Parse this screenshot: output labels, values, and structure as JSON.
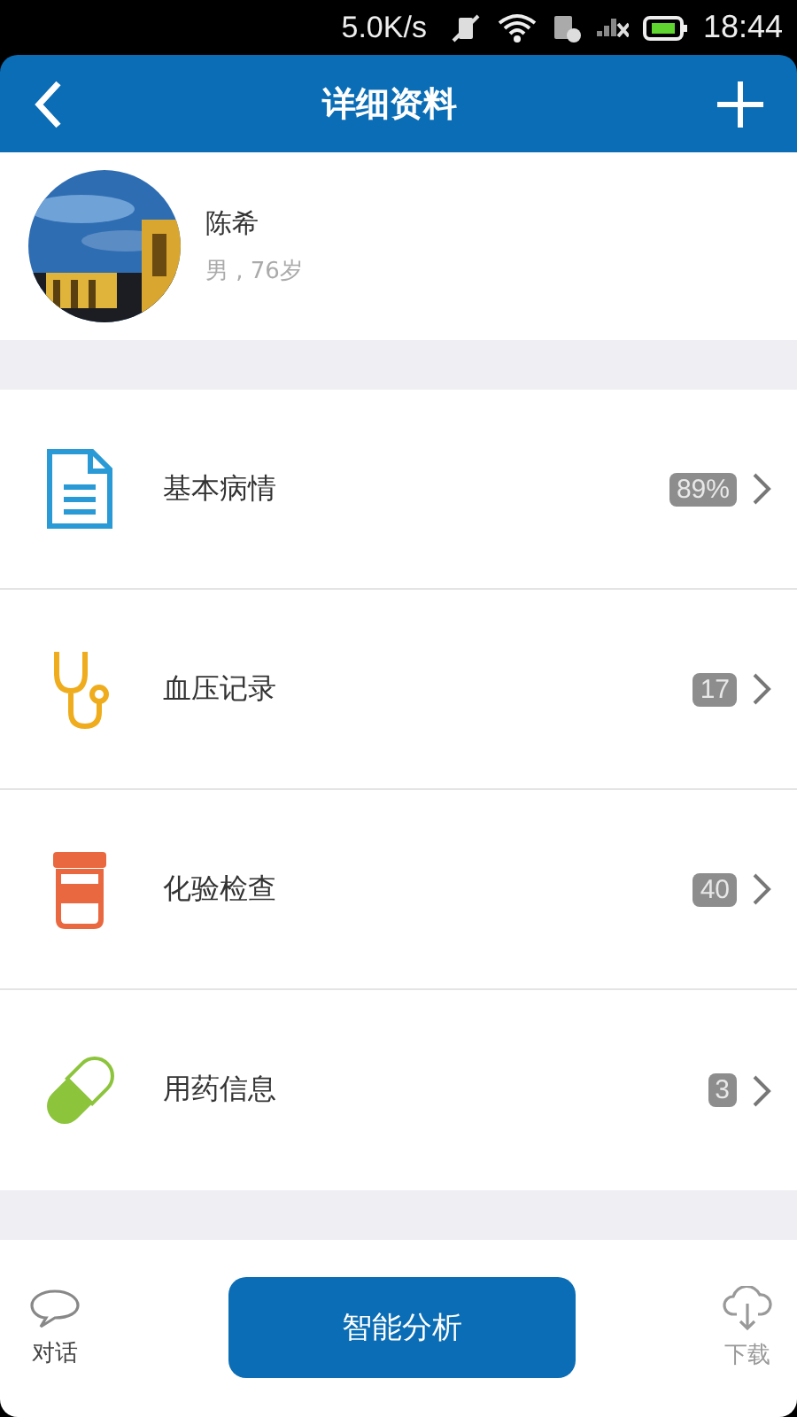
{
  "status_bar": {
    "speed": "5.0K/s",
    "time": "18:44"
  },
  "header": {
    "title": "详细资料"
  },
  "profile": {
    "name": "陈希",
    "info": "男 , 76岁"
  },
  "items": [
    {
      "kind": "document",
      "label": "基本病情",
      "count": "89%"
    },
    {
      "kind": "stethoscope",
      "label": "血压记录",
      "count": "17"
    },
    {
      "kind": "bottle",
      "label": "化验检查",
      "count": "40"
    },
    {
      "kind": "pill",
      "label": "用药信息",
      "count": "3"
    }
  ],
  "bottom_bar": {
    "left": {
      "kind": "chat",
      "label": "对话"
    },
    "button": "智能分析",
    "right": {
      "kind": "download",
      "label": "下载"
    }
  }
}
